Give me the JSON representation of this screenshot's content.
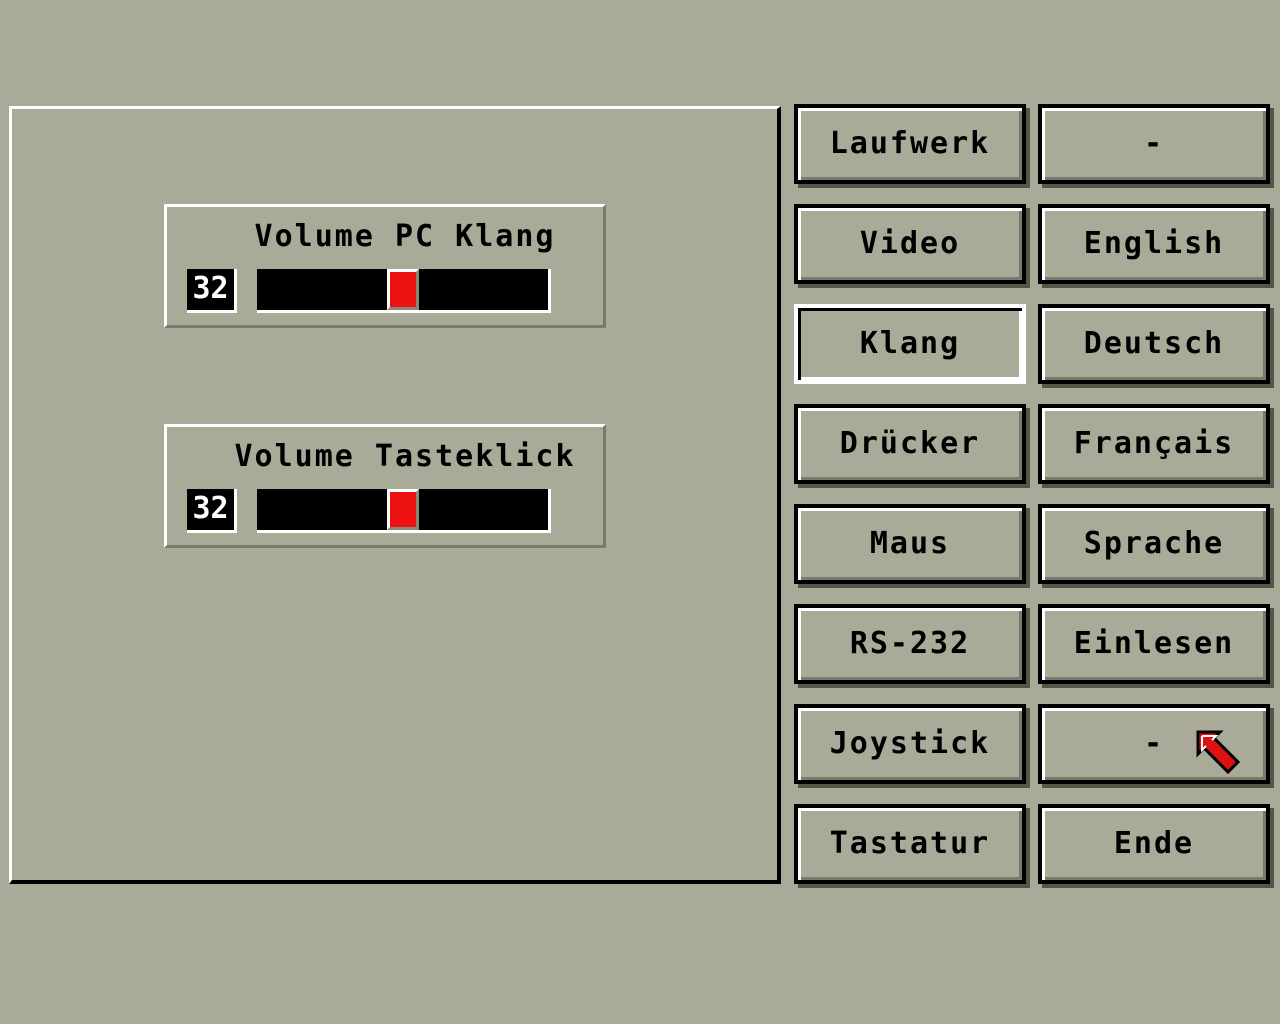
{
  "sliders": [
    {
      "title": "Volume PC Klang",
      "value": "32",
      "level": 0.5
    },
    {
      "title": "Volume Tasteklick",
      "value": "32",
      "level": 0.5
    }
  ],
  "menu": {
    "left_column": [
      "Laufwerk",
      "Video",
      "Klang",
      "Drücker",
      "Maus",
      "RS-232",
      "Joystick",
      "Tastatur"
    ],
    "right_column": [
      "-",
      "English",
      "Deutsch",
      "Français",
      "Sprache",
      "Einlesen",
      "-",
      "Ende"
    ],
    "selected": "Klang"
  },
  "colors": {
    "background": "#aaaa99",
    "knob": "#ee1111",
    "track": "#000000",
    "highlight": "#ffffff"
  },
  "icons": {
    "cursor": "mouse-pointer-arrow-icon"
  }
}
